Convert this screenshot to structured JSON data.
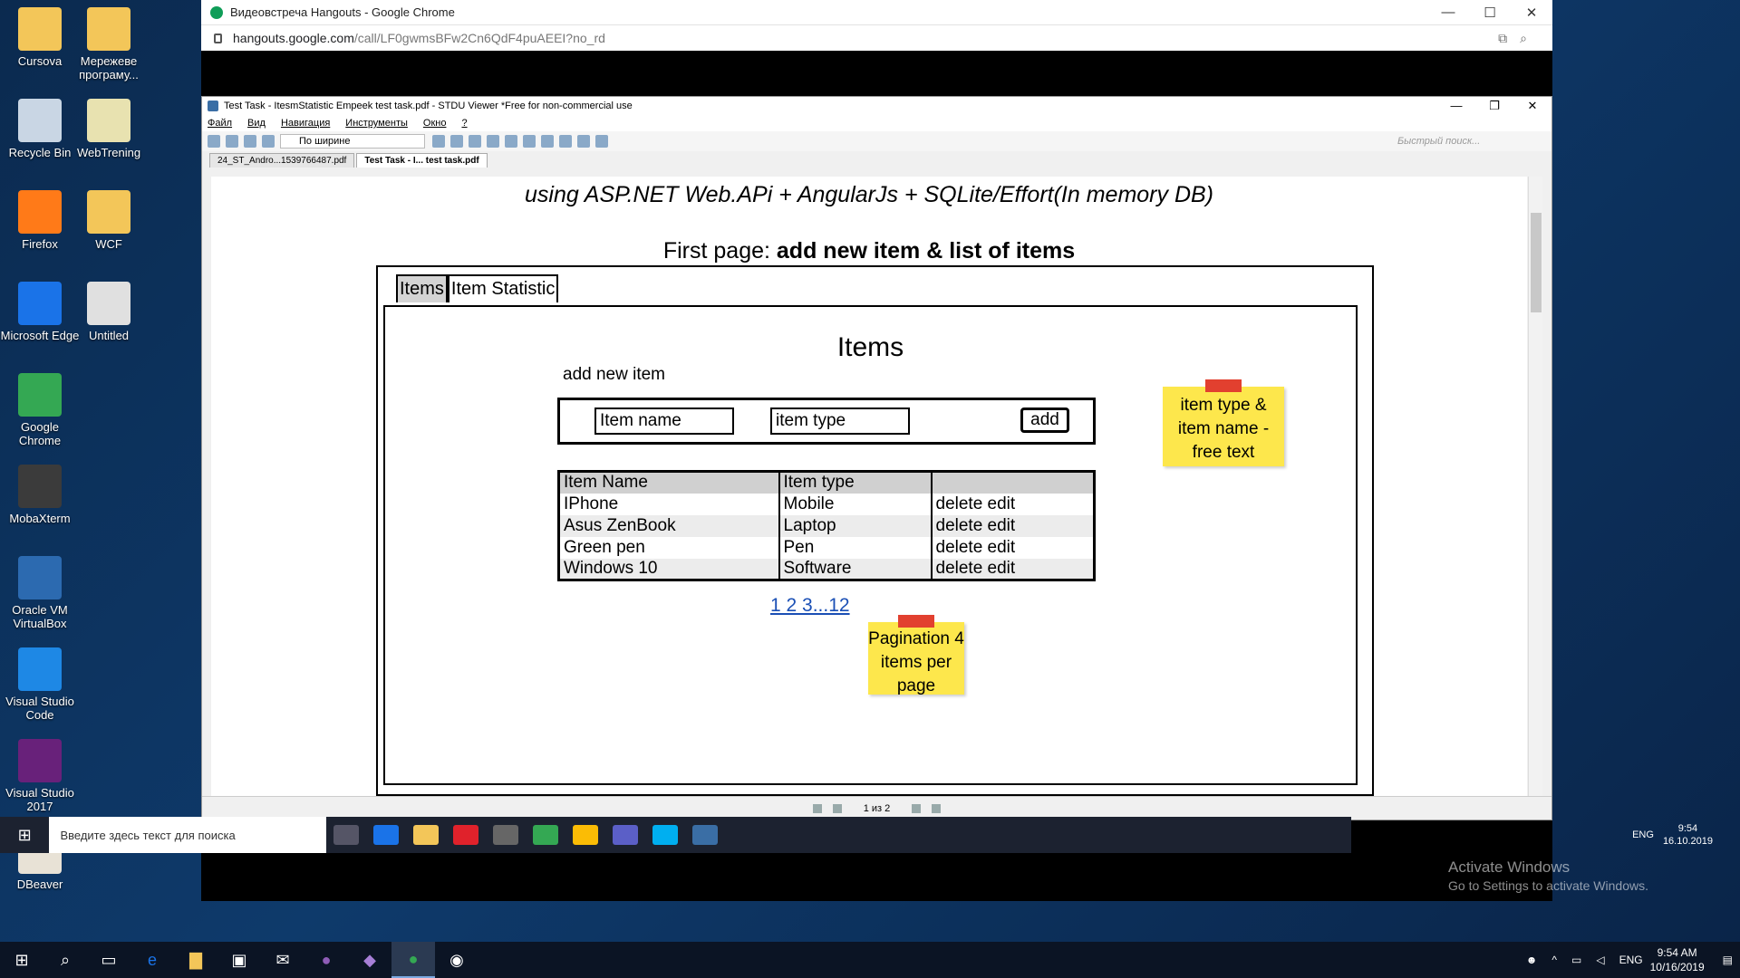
{
  "desktop_icons": [
    {
      "label": "Cursova",
      "color": "#f3c659"
    },
    {
      "label": "Мережеве програму...",
      "color": "#f3c659"
    },
    {
      "label": "Recycle Bin",
      "color": "#c9d6e4"
    },
    {
      "label": "WebTrening",
      "color": "#e8e2b0"
    },
    {
      "label": "Firefox",
      "color": "#ff7a18"
    },
    {
      "label": "WCF",
      "color": "#f3c659"
    },
    {
      "label": "Microsoft Edge",
      "color": "#1a73e8"
    },
    {
      "label": "Untitled",
      "color": "#e0e0e0"
    },
    {
      "label": "Google Chrome",
      "color": "#34a853"
    },
    {
      "label": "MobaXterm",
      "color": "#3b3b3b"
    },
    {
      "label": "Oracle VM VirtualBox",
      "color": "#2c6ab0"
    },
    {
      "label": "Visual Studio Code",
      "color": "#1e88e5"
    },
    {
      "label": "Visual Studio 2017",
      "color": "#68217a"
    },
    {
      "label": "DBeaver",
      "color": "#e8e2d6"
    }
  ],
  "chrome": {
    "title": "Видеовстреча Hangouts - Google Chrome",
    "url_host": "hangouts.google.com",
    "url_path": "/call/LF0gwmsBFw2Cn6QdF4puAEEI?no_rd",
    "min": "—",
    "max": "☐",
    "close": "✕"
  },
  "stdu": {
    "title": "Test Task - ItesmStatistic Empeek test task.pdf - STDU Viewer *Free for non-commercial use",
    "menu": [
      "Файл",
      "Вид",
      "Навигация",
      "Инструменты",
      "Окно",
      "?"
    ],
    "zoom": "По ширине",
    "search_placeholder": "Быстрый поиск...",
    "tabs": [
      "24_ST_Andro...1539766487.pdf",
      "Test Task - I... test task.pdf"
    ],
    "page_indicator": "1 из 2"
  },
  "doc": {
    "line1": "using ASP.NET Web.APi + AngularJs + SQLite/Effort(In memory DB)",
    "line2_a": "First page: ",
    "line2_b": "add new item & list of items",
    "tab_items": "Items",
    "tab_stat": "Item Statistic",
    "heading": "Items",
    "add_new": "add new item",
    "input_name": "Item name",
    "input_type": "item type",
    "add_btn": "add",
    "table_headers": [
      "Item Name",
      "Item type",
      ""
    ],
    "rows": [
      [
        "IPhone",
        "Mobile",
        "delete edit"
      ],
      [
        "Asus ZenBook",
        "Laptop",
        "delete edit"
      ],
      [
        "Green pen",
        "Pen",
        "delete edit"
      ],
      [
        "Windows 10",
        "Software",
        "delete edit"
      ]
    ],
    "pagination": "1 2 3...12",
    "note1": "item type & item name - free text",
    "note2": "Pagination 4 items per page"
  },
  "inner_taskbar": {
    "search": "Введите здесь текст для поиска",
    "lang": "ENG",
    "time": "9:54",
    "date": "16.10.2019"
  },
  "activate": {
    "line1": "Activate Windows",
    "line2": "Go to Settings to activate Windows."
  },
  "taskbar": {
    "lang": "ENG",
    "time": "9:54 AM",
    "date": "10/16/2019"
  }
}
